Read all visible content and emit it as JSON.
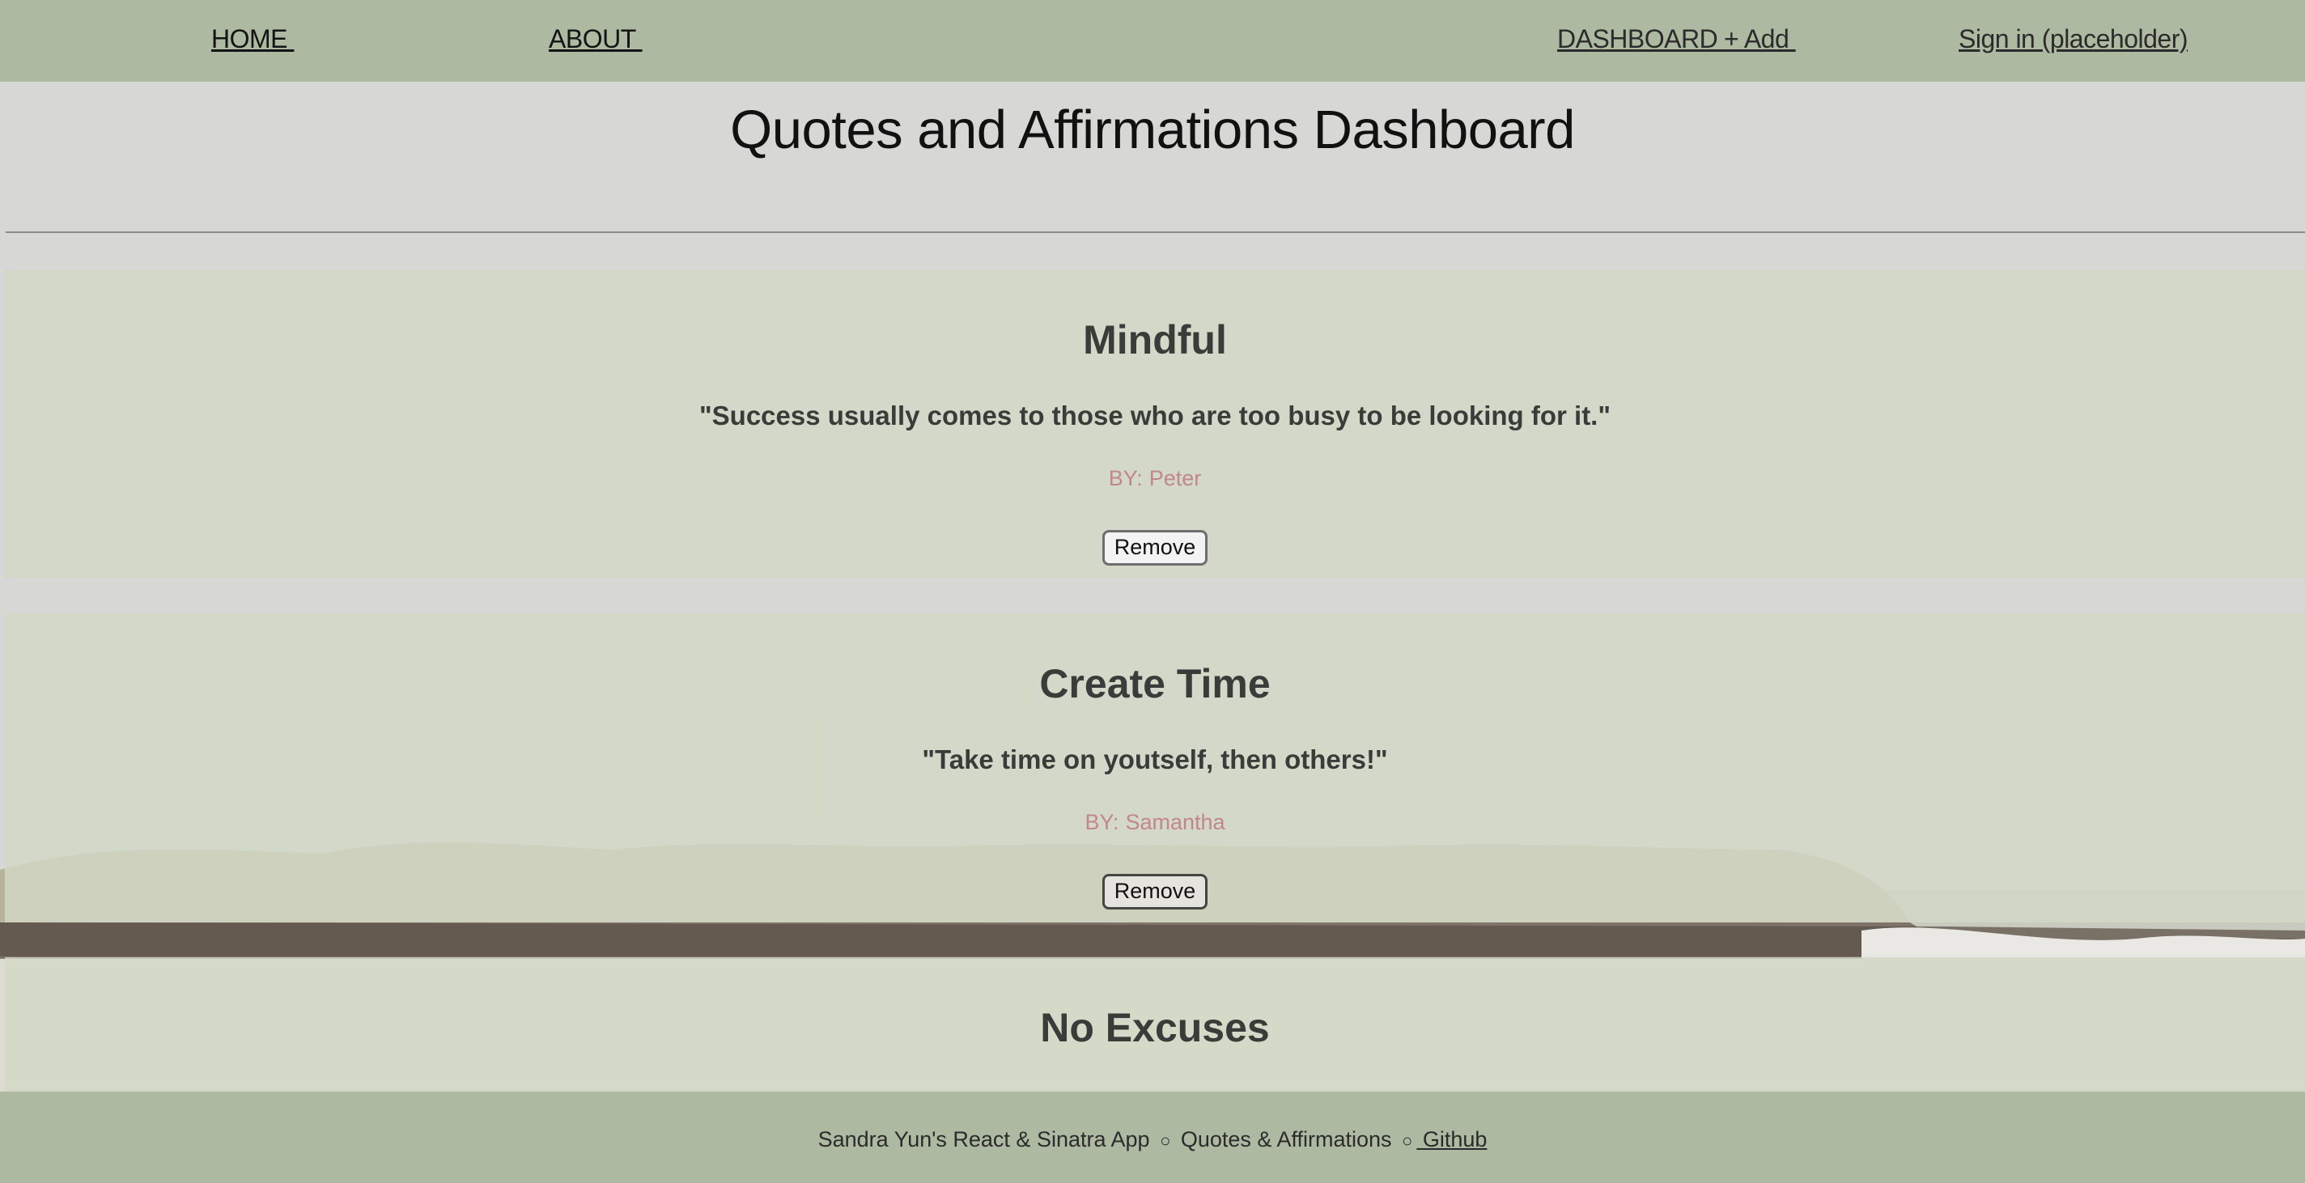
{
  "nav": {
    "home": "HOME ",
    "about": "ABOUT ",
    "dashboard": "DASHBOARD ",
    "add": "+ Add ",
    "sign_in": "Sign in (placeholder)"
  },
  "page": {
    "title": "Quotes and Affirmations Dashboard"
  },
  "cards": [
    {
      "category": "Mindful",
      "quote": "\"Success usually comes to those who are too busy to be looking for it.\"",
      "by_label": "BY:",
      "author": "Peter",
      "remove_label": "Remove"
    },
    {
      "category": "Create Time",
      "quote": "\"Take time on youtself, then others!\"",
      "by_label": "BY:",
      "author": "Samantha",
      "remove_label": "Remove"
    },
    {
      "category": "No Excuses"
    }
  ],
  "footer": {
    "credit": "Sandra Yun's React & Sinatra App",
    "separator": "○",
    "app_name": "Quotes & Affirmations",
    "separator2": "○",
    "github": " Github"
  },
  "colors": {
    "nav_bg": "#adb9a1",
    "card_bg": "#d3d8c4",
    "author_text": "#c1878b",
    "heading_text": "#3a3c39"
  },
  "icons": {
    "footer_separator": "circle-bullet-icon"
  }
}
